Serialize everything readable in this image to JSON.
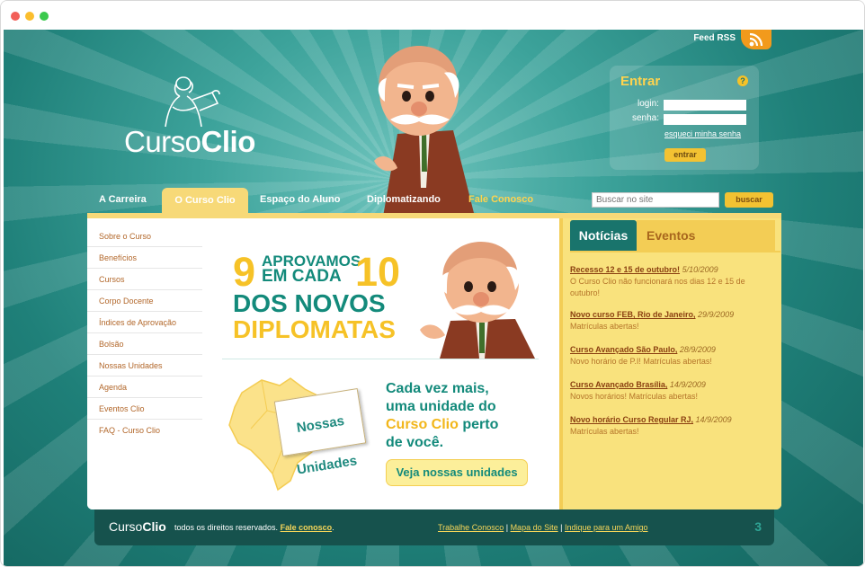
{
  "window": {
    "controls": {
      "close_color": "#f25f58",
      "minimize_color": "#fbbe2e",
      "maximize_color": "#3bc94d"
    }
  },
  "header": {
    "feed_label": "Feed RSS",
    "logo": {
      "light": "Curso",
      "bold": "Clio"
    },
    "mascot_icon": "professor-mascot",
    "rss_icon": "rss-icon"
  },
  "login": {
    "title": "Entrar",
    "help_glyph": "?",
    "login_label": "login:",
    "password_label": "senha:",
    "login_value": "",
    "password_value": "",
    "forgot_label": "esqueci minha senha",
    "submit_label": "entrar"
  },
  "nav": {
    "items": [
      {
        "label": "A Carreira",
        "active": false
      },
      {
        "label": "O Curso Clio",
        "active": true
      },
      {
        "label": "Espaço do Aluno",
        "active": false
      },
      {
        "label": "Diplomatizando",
        "active": false
      },
      {
        "label": "Fale Conosco",
        "active": false,
        "highlight": "#ffd34e"
      }
    ],
    "search_placeholder": "Buscar no site",
    "search_button": "buscar"
  },
  "sidebar": {
    "items": [
      "Sobre o Curso",
      "Benefícios",
      "Cursos",
      "Corpo Docente",
      "Índices de Aprovação",
      "Bolsão",
      "Nossas Unidades",
      "Agenda",
      "Eventos Clio",
      "FAQ - Curso Clio"
    ]
  },
  "promo": {
    "num_left": "9",
    "num_right": "10",
    "line1": "APROVAMOS",
    "line2": "EM CADA",
    "line3": "DOS NOVOS",
    "line4": "DIPLOMATAS",
    "card": [
      "Nossas",
      "Unidades"
    ],
    "unit_text": {
      "line1": "Cada vez mais,",
      "line2": "uma unidade do",
      "line3_yellow": "Curso Clio",
      "line3_rest": " perto",
      "line4": "de você."
    },
    "cta": "Veja nossas unidades",
    "map_icon": "brazil-map"
  },
  "news": {
    "tabs": [
      {
        "label": "Notícias",
        "active": true
      },
      {
        "label": "Eventos",
        "active": false
      }
    ],
    "items": [
      {
        "title": "Recesso 12 e 15 de outubro!",
        "date": "5/10/2009",
        "body": "O Curso Clio não funcionará nos dias 12 e 15 de outubro!"
      },
      {
        "title": "Novo curso FEB, Rio de Janeiro,",
        "date": "29/9/2009",
        "body": "Matrículas abertas!"
      },
      {
        "title": "Curso Avançado São Paulo,",
        "date": "28/9/2009",
        "body": "Novo horário de P.I! Matrículas abertas!"
      },
      {
        "title": "Curso Avançado Brasília,",
        "date": "14/9/2009",
        "body": "Novos horários! Matrículas abertas!"
      },
      {
        "title": "Novo horário Curso Regular RJ,",
        "date": "14/9/2009",
        "body": "Matrículas abertas!"
      }
    ]
  },
  "footer": {
    "logo": {
      "light": "Curso",
      "bold": "Clio"
    },
    "rights": "todos os direitos reservados.",
    "contact": "Fale conosco",
    "links": [
      "Trabalhe Conosco",
      "Mapa do Site",
      "Indique para um Amigo"
    ],
    "separator": " | ",
    "page_number": "3"
  },
  "colors": {
    "teal_dark": "#14655f",
    "teal_light": "#6fc4bd",
    "yellow": "#f6c227",
    "orange_link": "#b2672a"
  }
}
